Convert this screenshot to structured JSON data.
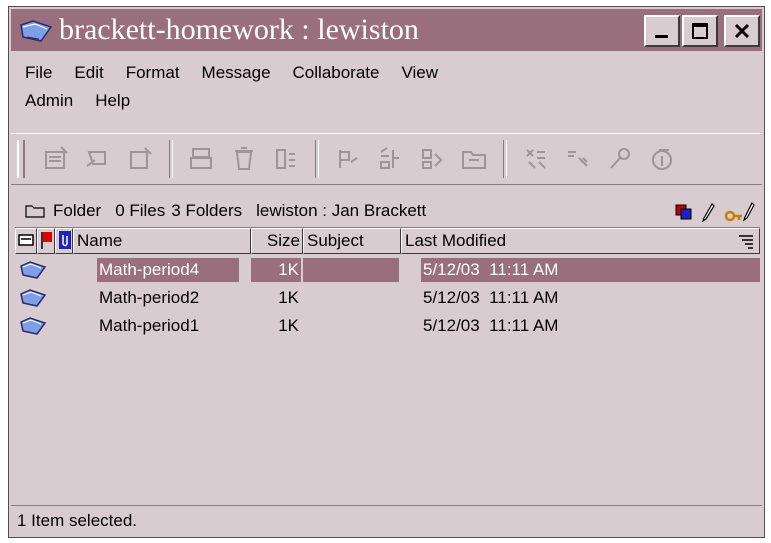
{
  "window": {
    "title": "brackett-homework : lewiston",
    "minimize_label": "_",
    "close_label": "X"
  },
  "menu": {
    "items": [
      {
        "label": "File"
      },
      {
        "label": "Edit"
      },
      {
        "label": "Format"
      },
      {
        "label": "Message"
      },
      {
        "label": "Collaborate"
      },
      {
        "label": "View"
      },
      {
        "label": "Admin"
      },
      {
        "label": "Help"
      }
    ]
  },
  "toolbar": {
    "icons": [
      "new-message-icon",
      "reply-icon",
      "forward-icon",
      "print-icon",
      "delete-icon",
      "move-icon",
      "flag-icon",
      "sort-icon",
      "attach-icon",
      "folder-icon",
      "search-icon",
      "copy-icon",
      "key-icon",
      "info-icon"
    ]
  },
  "info": {
    "kind": "Folder",
    "files": "0 Files",
    "folders": "3 Folders",
    "location": "lewiston : Jan Brackett"
  },
  "list": {
    "columns": {
      "name": "Name",
      "size": "Size",
      "subject": "Subject",
      "modified": "Last Modified"
    },
    "rows": [
      {
        "name": "Math-period4",
        "size": "1K",
        "subject": "",
        "modified": "5/12/03  11:11 AM",
        "selected": true
      },
      {
        "name": "Math-period2",
        "size": "1K",
        "subject": "",
        "modified": "5/12/03  11:11 AM",
        "selected": false
      },
      {
        "name": "Math-period1",
        "size": "1K",
        "subject": "",
        "modified": "5/12/03  11:11 AM",
        "selected": false
      }
    ]
  },
  "status": {
    "text": "1 Item selected."
  },
  "colors": {
    "accent": "#9a6f7d",
    "background": "#d8ccd0"
  }
}
